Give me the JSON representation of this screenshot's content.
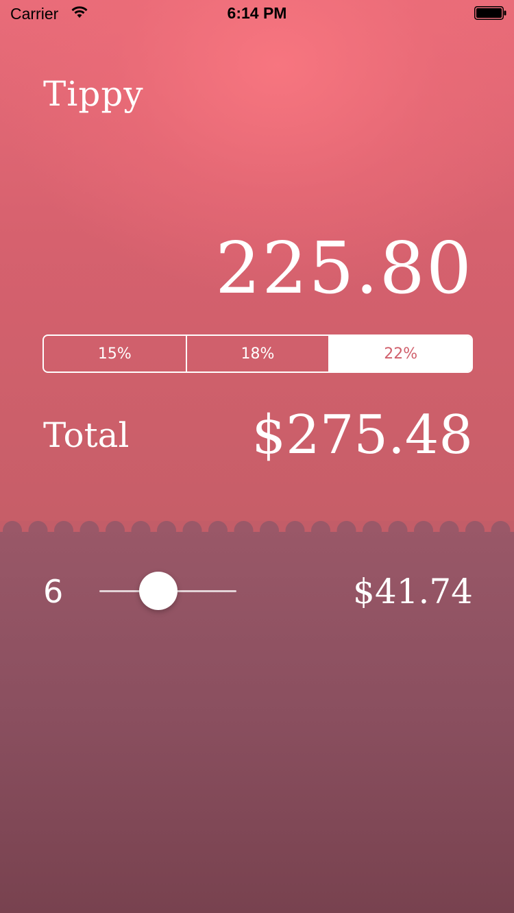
{
  "status_bar": {
    "carrier": "Carrier",
    "time": "6:14 PM"
  },
  "app": {
    "title": "Tippy"
  },
  "bill": {
    "amount": "225.80"
  },
  "tip_options": [
    {
      "label": "15%",
      "selected": false
    },
    {
      "label": "18%",
      "selected": false
    },
    {
      "label": "22%",
      "selected": true
    }
  ],
  "total": {
    "label": "Total",
    "value": "$275.48"
  },
  "split": {
    "count": "6",
    "slider_fraction": 0.43,
    "per_person": "$41.74"
  },
  "colors": {
    "accent": "#d0606c",
    "top_background": "#e96c79",
    "bottom_background": "#8a4f5f"
  }
}
